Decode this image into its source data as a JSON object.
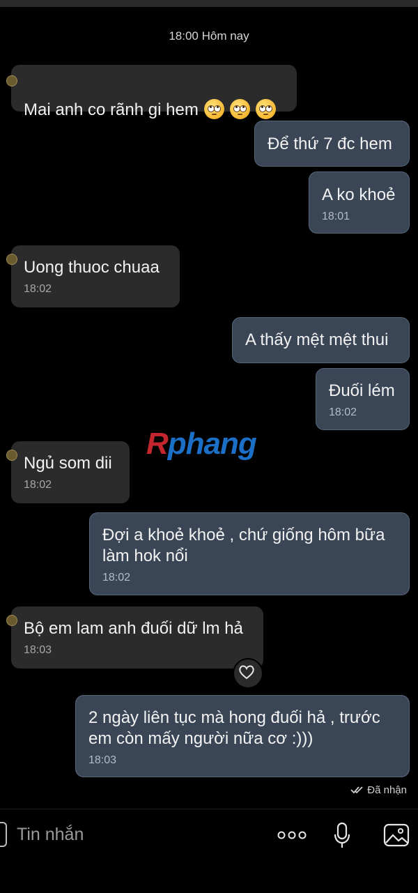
{
  "chat": {
    "date_separator": "18:00 Hôm nay",
    "messages": [
      {
        "side": "in",
        "text": "Mai anh co rãnh gi hem",
        "emoji_count": 3,
        "emoji": "rolling-eyes-emoji",
        "time": ""
      },
      {
        "side": "out",
        "text": "Để thứ 7 đc hem",
        "time": ""
      },
      {
        "side": "out",
        "text": "A ko khoẻ",
        "time": "18:01"
      },
      {
        "side": "in",
        "text": "Uong thuoc chuaa",
        "time": "18:02"
      },
      {
        "side": "out",
        "text": "A thấy mệt mệt thui",
        "time": ""
      },
      {
        "side": "out",
        "text": "Đuối lém",
        "time": "18:02"
      },
      {
        "side": "in",
        "text": "Ngủ som dii",
        "time": "18:02"
      },
      {
        "side": "out",
        "text": "Đợi a khoẻ khoẻ , chứ giống hôm bữa\nlàm hok nổi",
        "time": "18:02"
      },
      {
        "side": "in",
        "text": "Bộ em lam anh đuối dữ lm hả",
        "time": "18:03",
        "reaction_icon": "heart-icon"
      },
      {
        "side": "out",
        "text": "2 ngày liên tục mà hong đuối hả , trước\nem còn mấy người nữa cơ :)))",
        "time": "18:03"
      }
    ],
    "delivery_status": "Đã nhận"
  },
  "watermark": {
    "part1": "R",
    "part2": "phang"
  },
  "composer": {
    "placeholder": "Tin nhắn",
    "icons": [
      "more-icon",
      "microphone-icon",
      "image-icon"
    ]
  },
  "colors": {
    "background": "#000000",
    "incoming_bubble": "#2b2b2b",
    "outgoing_bubble": "#3a4656",
    "outgoing_border": "#56657a"
  }
}
